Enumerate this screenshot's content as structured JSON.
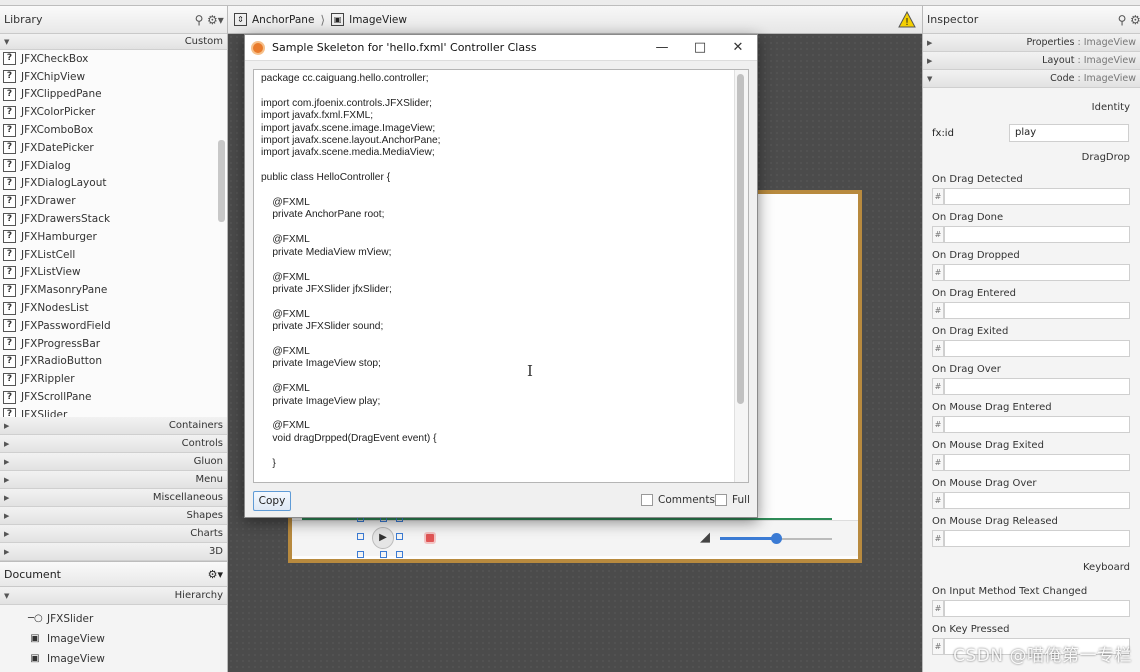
{
  "library": {
    "title": "Library",
    "custom_label": "Custom",
    "items": [
      "JFXCheckBox",
      "JFXChipView",
      "JFXClippedPane",
      "JFXColorPicker",
      "JFXComboBox",
      "JFXDatePicker",
      "JFXDialog",
      "JFXDialogLayout",
      "JFXDrawer",
      "JFXDrawersStack",
      "JFXHamburger",
      "JFXListCell",
      "JFXListView",
      "JFXMasonryPane",
      "JFXNodesList",
      "JFXPasswordField",
      "JFXProgressBar",
      "JFXRadioButton",
      "JFXRippler",
      "JFXScrollPane",
      "JFXSlider"
    ],
    "categories": [
      "Containers",
      "Controls",
      "Gluon",
      "Menu",
      "Miscellaneous",
      "Shapes",
      "Charts",
      "3D"
    ]
  },
  "document": {
    "title": "Document",
    "hierarchy_label": "Hierarchy",
    "tree": [
      "JFXSlider",
      "ImageView",
      "ImageView"
    ]
  },
  "breadcrumb": [
    "AnchorPane",
    "ImageView"
  ],
  "dialog": {
    "title": "Sample Skeleton for 'hello.fxml' Controller Class",
    "code": "package cc.caiguang.hello.controller;\n\nimport com.jfoenix.controls.JFXSlider;\nimport javafx.fxml.FXML;\nimport javafx.scene.image.ImageView;\nimport javafx.scene.layout.AnchorPane;\nimport javafx.scene.media.MediaView;\n\npublic class HelloController {\n\n    @FXML\n    private AnchorPane root;\n\n    @FXML\n    private MediaView mView;\n\n    @FXML\n    private JFXSlider jfxSlider;\n\n    @FXML\n    private JFXSlider sound;\n\n    @FXML\n    private ImageView stop;\n\n    @FXML\n    private ImageView play;\n\n    @FXML\n    void dragDrpped(DragEvent event) {\n\n    }",
    "copy_label": "Copy",
    "comments_label": "Comments",
    "full_label": "Full"
  },
  "inspector": {
    "title": "Inspector",
    "sections": [
      {
        "name": "Properties",
        "sub": " : ImageView"
      },
      {
        "name": "Layout",
        "sub": " : ImageView"
      },
      {
        "name": "Code",
        "sub": " : ImageView"
      }
    ],
    "identity_label": "Identity",
    "fxid_label": "fx:id",
    "fxid_value": "play",
    "dragdrop_label": "DragDrop",
    "dragdrop_props": [
      "On Drag Detected",
      "On Drag Done",
      "On Drag Dropped",
      "On Drag Entered",
      "On Drag Exited",
      "On Drag Over",
      "On Mouse Drag Entered",
      "On Mouse Drag Exited",
      "On Mouse Drag Over",
      "On Mouse Drag Released"
    ],
    "keyboard_label": "Keyboard",
    "keyboard_props": [
      "On Input Method Text Changed",
      "On Key Pressed"
    ],
    "hash": "#"
  },
  "watermark": "CSDN @喵俺第一专栏",
  "colors": {
    "accent": "#3b7bd4",
    "seek": "#2e8b57",
    "frame": "#b88a3e",
    "stop": "#e05555"
  }
}
